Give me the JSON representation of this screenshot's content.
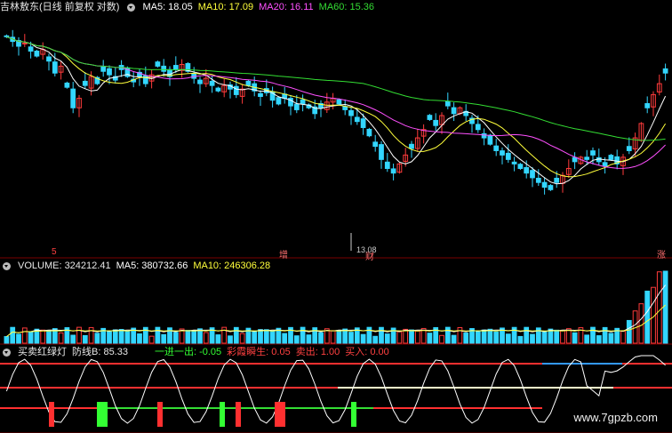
{
  "price_header": {
    "title": "吉林敖东(日线 前复权 对数)",
    "ma5": "MA5: 18.05",
    "ma10": "MA10: 17.09",
    "ma20": "MA20: 16.11",
    "ma60": "MA60: 15.36"
  },
  "volume_header": {
    "title": "VOLUME: 324212.41",
    "ma5": "MA5: 380732.66",
    "ma10": "MA10: 246306.28"
  },
  "indicator_header": {
    "title": "买卖红绿灯",
    "line": "防线B: 85.33",
    "signal1": "一进一出: -0.05",
    "signal2": "彩霞瞬生: 0.05",
    "signal3": "卖出: 1.00",
    "signal4": "买入: 0.00"
  },
  "markers": {
    "left": "5",
    "zeng": "增",
    "cai": "财",
    "zhang": "涨",
    "low_value": "13.08"
  },
  "watermark": "www.7gpzb.com",
  "colors": {
    "up": "#ff3b3b",
    "down": "#33d6ff",
    "ma5": "#ffffff",
    "ma10": "#ffff3b",
    "ma20": "#ff50ff",
    "ma60": "#33dd33",
    "panel_line": "#7a0000"
  },
  "chart_data": [
    {
      "type": "candlestick",
      "title": "吉林敖东(日线 前复权 对数)",
      "close": [
        22.4,
        22.1,
        21.8,
        22.0,
        21.5,
        21.2,
        21.6,
        20.9,
        20.2,
        20.6,
        19.4,
        18.3,
        18.8,
        19.5,
        20.0,
        19.6,
        20.3,
        20.1,
        19.8,
        20.4,
        20.0,
        19.7,
        20.0,
        19.6,
        20.1,
        20.6,
        20.3,
        20.0,
        20.4,
        20.7,
        20.3,
        19.9,
        19.6,
        19.9,
        19.5,
        19.2,
        19.5,
        19.3,
        19.0,
        19.3,
        19.5,
        19.2,
        18.9,
        19.1,
        18.7,
        18.5,
        18.8,
        18.4,
        18.2,
        18.5,
        18.3,
        18.0,
        18.3,
        18.6,
        18.8,
        18.5,
        18.2,
        17.9,
        17.6,
        17.3,
        16.9,
        16.4,
        15.8,
        15.4,
        15.2,
        15.6,
        16.0,
        16.3,
        16.8,
        17.2,
        17.7,
        17.4,
        17.9,
        18.4,
        18.0,
        18.3,
        17.9,
        17.5,
        17.2,
        16.8,
        16.5,
        16.2,
        16.0,
        15.8,
        15.6,
        15.4,
        15.2,
        15.0,
        14.8,
        14.6,
        14.5,
        14.8,
        15.1,
        15.4,
        15.7,
        15.9,
        15.8,
        16.0,
        15.7,
        15.5,
        15.8,
        15.6,
        15.9,
        16.2,
        16.8,
        17.5,
        18.3,
        19.0,
        19.6,
        20.2
      ],
      "ma60_last": 15.36,
      "ma20_last": 16.11,
      "ma10_last": 17.09,
      "ma5_last": 18.05,
      "low_marker": 13.08
    },
    {
      "type": "bar",
      "title": "VOLUME",
      "latest": 324212.41,
      "ma5": 380732.66,
      "ma10": 246306.28
    }
  ]
}
